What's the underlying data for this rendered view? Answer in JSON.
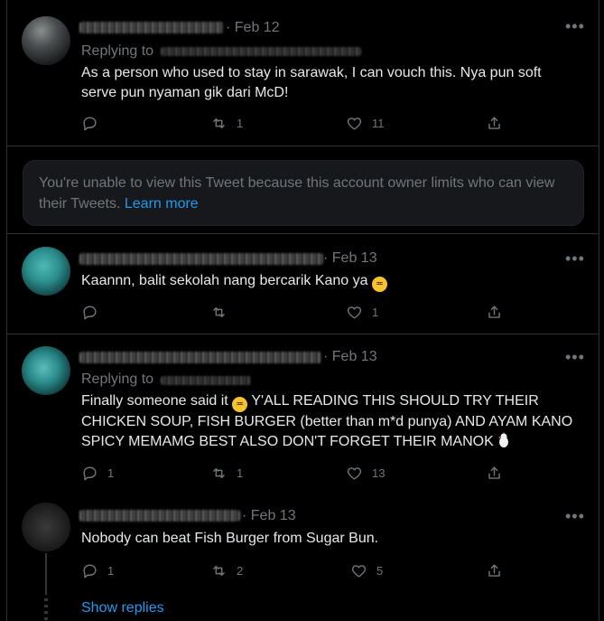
{
  "tweets": [
    {
      "date": "· Feb 12",
      "replying_to": "Replying to",
      "text": "As a person who used to stay in sarawak, I can vouch this. Nya pun soft serve pun nyaman gik dari McD!",
      "replies": "",
      "retweets": "1",
      "likes": "11"
    },
    {
      "date": "· Feb 13",
      "text_before_emoji": "Kaannn, balit sekolah nang bercarik Kano ya",
      "emoji_name": "weary-face-emoji",
      "replies": "",
      "retweets": "",
      "likes": "1"
    },
    {
      "date": "· Feb 13",
      "replying_to": "Replying to",
      "text_part1": "Finally someone said it",
      "text_part2": "Y'ALL READING THIS SHOULD TRY THEIR CHICKEN SOUP, FISH BURGER (better than m*d punya) AND AYAM KANO SPICY MEMAMG BEST ALSO DON'T FORGET THEIR MANOK",
      "replies": "1",
      "retweets": "1",
      "likes": "13"
    },
    {
      "date": "· Feb 13",
      "text": "Nobody can beat Fish Burger from Sugar Bun.",
      "replies": "1",
      "retweets": "2",
      "likes": "5"
    }
  ],
  "notice": {
    "text": "You're unable to view this Tweet because this account owner limits who can view their Tweets.",
    "link": "Learn more"
  },
  "show_replies": "Show replies",
  "more_label": "•••",
  "colors": {
    "background": "#000000",
    "text": "#e7e9ea",
    "muted": "#71767b",
    "link": "#1d9bf0",
    "card": "#16181c"
  }
}
